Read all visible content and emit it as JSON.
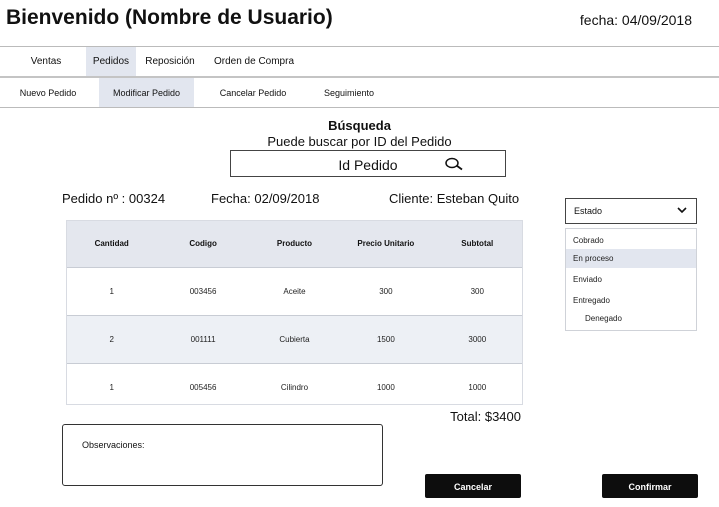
{
  "header": {
    "title": "Bienvenido (Nombre de Usuario)",
    "date": "fecha: 04/09/2018"
  },
  "main_tabs": [
    {
      "label": "Ventas"
    },
    {
      "label": "Pedidos"
    },
    {
      "label": "Reposición"
    },
    {
      "label": "Orden de Compra"
    }
  ],
  "sub_tabs": [
    {
      "label": "Nuevo Pedido"
    },
    {
      "label": "Modificar Pedido"
    },
    {
      "label": "Cancelar Pedido"
    },
    {
      "label": "Seguimiento"
    }
  ],
  "search": {
    "heading": "Búsqueda",
    "hint": "Puede buscar por ID del Pedido",
    "placeholder": "Id Pedido"
  },
  "order": {
    "number": "Pedido nº : 00324",
    "date": "Fecha: 02/09/2018",
    "client": "Cliente: Esteban Quito"
  },
  "table": {
    "headers": [
      "Cantidad",
      "Codigo",
      "Producto",
      "Precio Unitario",
      "Subtotal"
    ],
    "rows": [
      [
        "1",
        "003456",
        "Aceite",
        "300",
        "300"
      ],
      [
        "2",
        "001111",
        "Cubierta",
        "1500",
        "3000"
      ],
      [
        "1",
        "005456",
        "Cilindro",
        "1000",
        "1000"
      ]
    ]
  },
  "total": "Total: $3400",
  "observations": {
    "label": "Observaciones:"
  },
  "buttons": {
    "cancel": "Cancelar",
    "confirm": "Confirmar"
  },
  "status": {
    "label": "Estado",
    "options": [
      "Cobrado",
      "En proceso",
      "Enviado",
      "Entregado",
      "Denegado"
    ],
    "selected": "En proceso"
  },
  "icons": {
    "search": "search-icon",
    "dropdown": "chevron-down-icon"
  },
  "colors": {
    "active_tab": "#e2e6ef",
    "button": "#0d0d0d",
    "table_header": "#e4e7ee"
  }
}
